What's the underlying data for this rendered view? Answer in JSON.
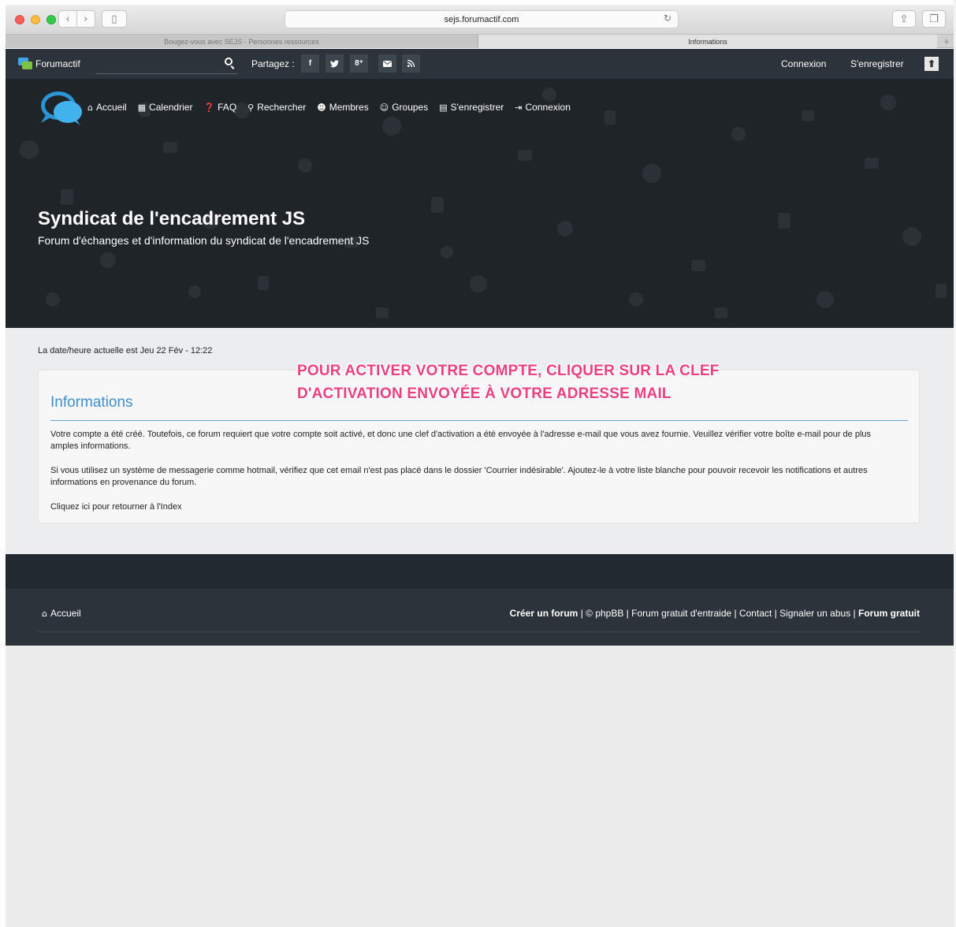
{
  "browser": {
    "url": "sejs.forumactif.com",
    "tabs": [
      {
        "label": "Bougez-vous avec SEJS - Personnes ressources"
      },
      {
        "label": "Informations"
      }
    ],
    "new_tab": "+"
  },
  "topbar": {
    "brand": "Forumactif",
    "share_label": "Partagez :",
    "social": [
      "f",
      "t",
      "g+",
      "mail",
      "rss"
    ],
    "connexion": "Connexion",
    "register": "S'enregistrer"
  },
  "hero": {
    "nav": [
      {
        "label": "Accueil",
        "icon": "home-icon"
      },
      {
        "label": "Calendrier",
        "icon": "calendar-icon"
      },
      {
        "label": "FAQ",
        "icon": "help-icon"
      },
      {
        "label": "Rechercher",
        "icon": "search-icon"
      },
      {
        "label": "Membres",
        "icon": "members-icon"
      },
      {
        "label": "Groupes",
        "icon": "groups-icon"
      },
      {
        "label": "S'enregistrer",
        "icon": "register-icon"
      },
      {
        "label": "Connexion",
        "icon": "login-icon"
      }
    ],
    "title": "Syndicat de l'encadrement JS",
    "subtitle": "Forum d'échanges et d'information du syndicat de l'encadrement JS"
  },
  "content": {
    "datetime": "La date/heure actuelle est Jeu 22 Fév - 12:22",
    "annotation_line1": "POUR ACTIVER VOTRE COMPTE, CLIQUER SUR LA CLEF",
    "annotation_line2": "D'ACTIVATION ENVOYÉE À VOTRE ADRESSE MAIL",
    "panel_title": "Informations",
    "paragraph1": "Votre compte a été créé. Toutefois, ce forum requiert que votre compte soit activé, et donc une clef d'activation a été envoyée à l'adresse e-mail que vous avez fournie. Veuillez vérifier votre boîte e-mail pour de plus amples informations.",
    "paragraph2": "Si vous utilisez un système de messagerie comme hotmail, vérifiez que cet email n'est pas placé dans le dossier 'Courrier indésirable'. Ajoutez-le à votre liste blanche pour pouvoir recevoir les notifications et autres informations en provenance du forum.",
    "paragraph3": "Cliquez ici pour retourner à l'Index"
  },
  "footer": {
    "home": "Accueil",
    "create_forum": "Créer un forum",
    "sep1": " | © phpBB | ",
    "free_help": "Forum gratuit d'entraide",
    "sep2": " | ",
    "contact": "Contact",
    "sep3": " | ",
    "report": "Signaler un abus",
    "sep4": " | ",
    "free_forum": "Forum gratuit"
  },
  "colors": {
    "accent": "#3e8ed0",
    "annotation": "#ee3f7d",
    "topbar": "#2c333a"
  }
}
